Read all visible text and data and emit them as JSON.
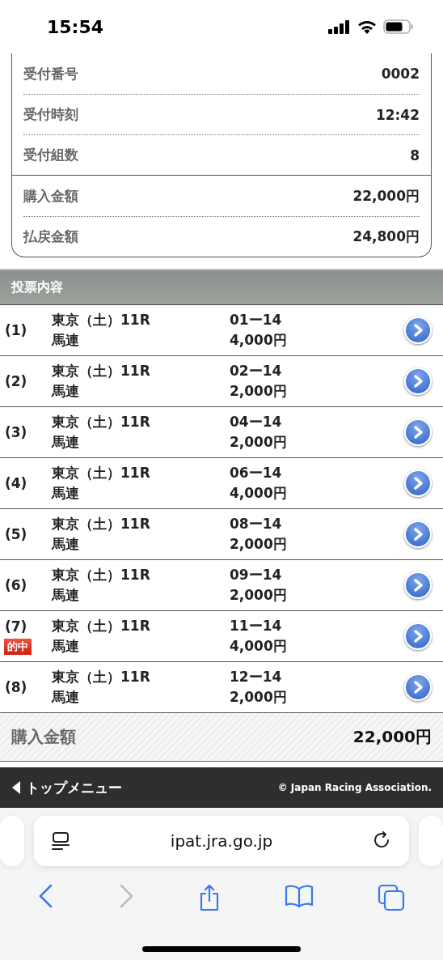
{
  "status_bar": {
    "time": "15:54"
  },
  "receipt": {
    "groups": [
      [
        {
          "label": "受付番号",
          "value": "0002"
        },
        {
          "label": "受付時刻",
          "value": "12:42"
        },
        {
          "label": "受付組数",
          "value": "8"
        }
      ],
      [
        {
          "label": "購入金額",
          "value": "22,000円"
        },
        {
          "label": "払戻金額",
          "value": "24,800円"
        }
      ]
    ]
  },
  "bets": {
    "title": "投票内容",
    "rows": [
      {
        "no": "(1)",
        "race": "東京（土）11R",
        "type": "馬連",
        "combo": "01ー14",
        "amount": "4,000円",
        "hit": false
      },
      {
        "no": "(2)",
        "race": "東京（土）11R",
        "type": "馬連",
        "combo": "02ー14",
        "amount": "2,000円",
        "hit": false
      },
      {
        "no": "(3)",
        "race": "東京（土）11R",
        "type": "馬連",
        "combo": "04ー14",
        "amount": "2,000円",
        "hit": false
      },
      {
        "no": "(4)",
        "race": "東京（土）11R",
        "type": "馬連",
        "combo": "06ー14",
        "amount": "4,000円",
        "hit": false
      },
      {
        "no": "(5)",
        "race": "東京（土）11R",
        "type": "馬連",
        "combo": "08ー14",
        "amount": "2,000円",
        "hit": false
      },
      {
        "no": "(6)",
        "race": "東京（土）11R",
        "type": "馬連",
        "combo": "09ー14",
        "amount": "2,000円",
        "hit": false
      },
      {
        "no": "(7)",
        "race": "東京（土）11R",
        "type": "馬連",
        "combo": "11ー14",
        "amount": "4,000円",
        "hit": true,
        "hit_label": "的中"
      },
      {
        "no": "(8)",
        "race": "東京（土）11R",
        "type": "馬連",
        "combo": "12ー14",
        "amount": "2,000円",
        "hit": false
      }
    ]
  },
  "total": {
    "label": "購入金額",
    "value": "22,000円"
  },
  "footer": {
    "link": "トップメニュー",
    "copyright": "© Japan Racing Association."
  },
  "browser": {
    "url": "ipat.jra.go.jp",
    "back_disabled": false,
    "forward_disabled": true
  }
}
